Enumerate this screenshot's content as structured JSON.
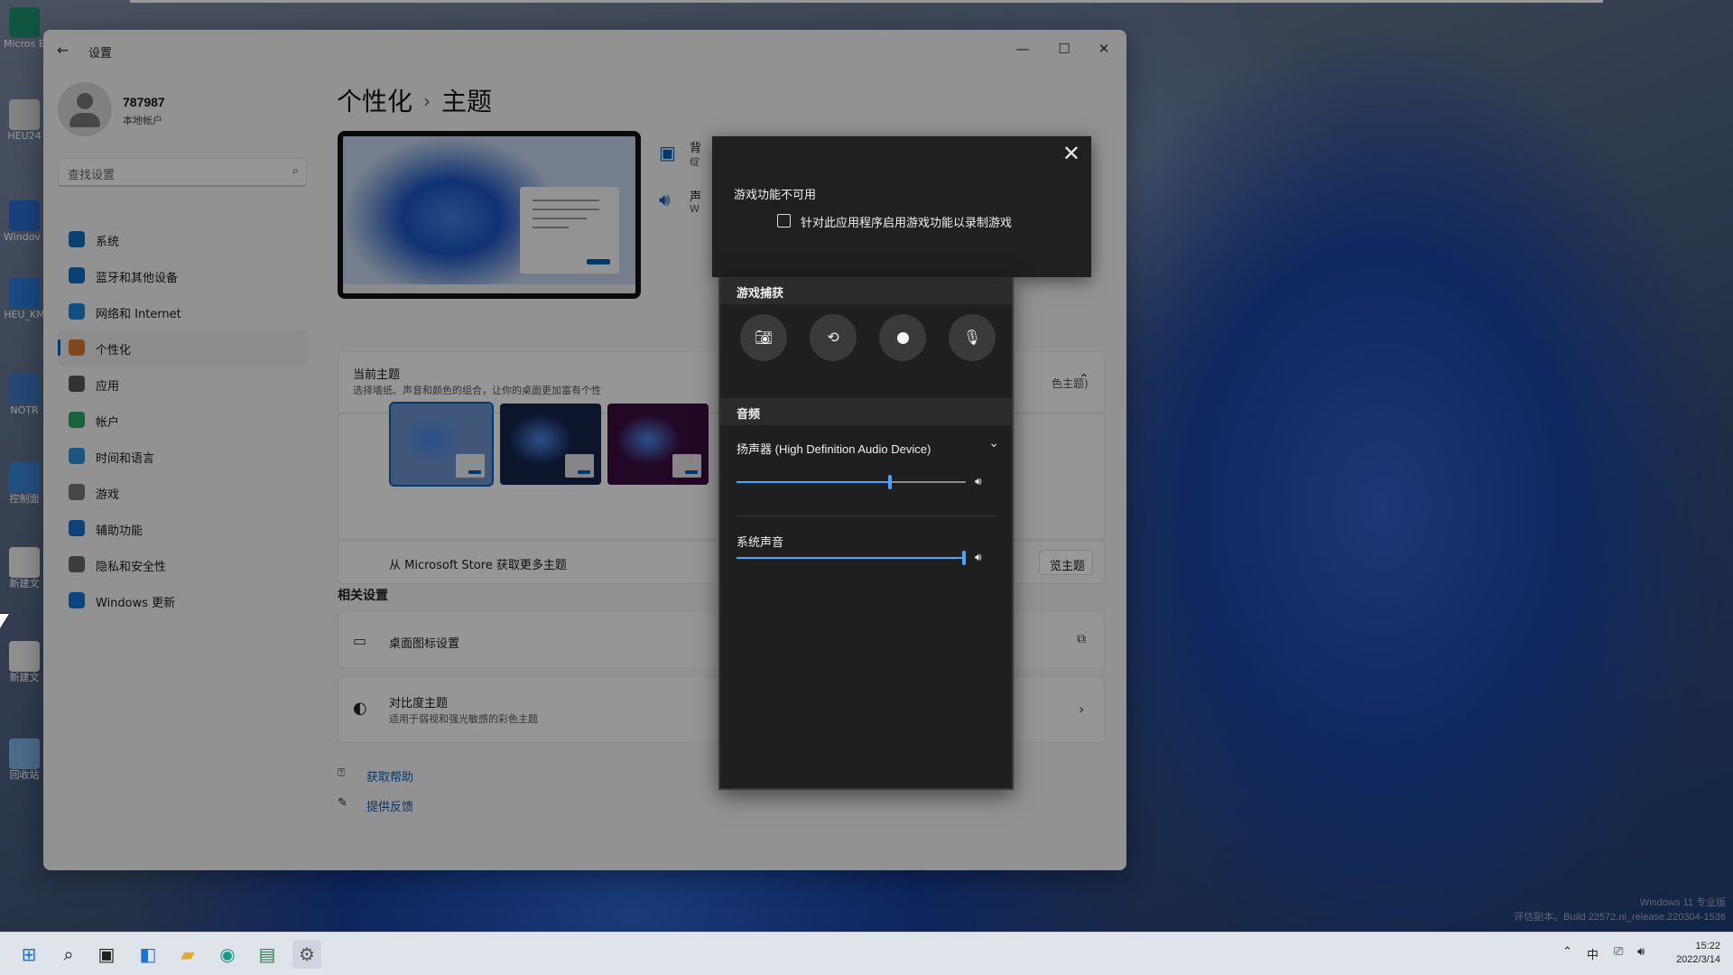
{
  "desktop": {
    "icons": [
      {
        "label": "Micros Edg",
        "color": "#1f8f6f"
      },
      {
        "label": "HEU24",
        "color": "#d9d9d9"
      },
      {
        "label": "Windov 22572.1",
        "color": "#2a6bd1"
      },
      {
        "label": "HEU_KM",
        "color": "#2b7bd6"
      },
      {
        "label": "NOTR",
        "color": "#3f78c9"
      },
      {
        "label": "控制面",
        "color": "#3a86d6"
      },
      {
        "label": "新建文",
        "color": "#eeeeee"
      },
      {
        "label": "新建文",
        "color": "#eeeeee"
      },
      {
        "label": "回收站",
        "color": "#7fb2e6"
      }
    ],
    "watermark_line1": "Windows 11 专业版",
    "watermark_line2": "评估副本。Build 22572.ni_release.220304-1536"
  },
  "settings": {
    "window_title": "设置",
    "back_icon": "back-arrow-icon",
    "user": {
      "name": "787987",
      "account_type": "本地帐户"
    },
    "search_placeholder": "查找设置",
    "nav": [
      {
        "label": "系统",
        "icon": "system-icon",
        "color": "#0f6cbd"
      },
      {
        "label": "蓝牙和其他设备",
        "icon": "bluetooth-icon",
        "color": "#0f6cbd"
      },
      {
        "label": "网络和 Internet",
        "icon": "network-icon",
        "color": "#1a86d8"
      },
      {
        "label": "个性化",
        "icon": "personalization-icon",
        "color": "#d07a2e",
        "active": true
      },
      {
        "label": "应用",
        "icon": "apps-icon",
        "color": "#555555"
      },
      {
        "label": "帐户",
        "icon": "accounts-icon",
        "color": "#2aa36b"
      },
      {
        "label": "时间和语言",
        "icon": "time-language-icon",
        "color": "#2d8fd6"
      },
      {
        "label": "游戏",
        "icon": "gaming-icon",
        "color": "#777777"
      },
      {
        "label": "辅助功能",
        "icon": "accessibility-icon",
        "color": "#1b6fcb"
      },
      {
        "label": "隐私和安全性",
        "icon": "privacy-icon",
        "color": "#666666"
      },
      {
        "label": "Windows 更新",
        "icon": "windows-update-icon",
        "color": "#1476d4"
      }
    ],
    "breadcrumb": {
      "parent": "个性化",
      "separator": "›",
      "current": "主题"
    },
    "side_rows": [
      {
        "label": "背",
        "sub": "绽",
        "icon": "background-icon"
      },
      {
        "label": "声",
        "sub": "W",
        "icon": "sound-icon"
      }
    ],
    "current_theme": {
      "title": "当前主题",
      "subtitle": "选择墙纸、声音和颜色的组合，让你的桌面更加富有个性",
      "value": "色主题)",
      "chevron": "chevron-up-icon",
      "thumbnails": [
        {
          "bg": "#6d92cc",
          "selected": true
        },
        {
          "bg": "#17244a",
          "selected": false
        },
        {
          "bg": "#3a0e3e",
          "selected": false
        }
      ],
      "store_text": "从 Microsoft Store 获取更多主题",
      "browse_button": "览主题"
    },
    "related_title": "相关设置",
    "related": [
      {
        "title": "桌面图标设置",
        "icon": "desktop-icon",
        "action_icon": "external-link-icon"
      },
      {
        "title": "对比度主题",
        "subtitle": "适用于弱视和强光敏感的彩色主题",
        "icon": "contrast-icon",
        "action_icon": "chevron-right-icon"
      }
    ],
    "links": [
      {
        "label": "获取帮助",
        "icon": "help-icon"
      },
      {
        "label": "提供反馈",
        "icon": "feedback-icon"
      }
    ]
  },
  "gamebar": {
    "warning": {
      "message": "游戏功能不可用",
      "checkbox_label": "针对此应用程序启用游戏功能以录制游戏",
      "checked": false
    },
    "capture": {
      "title": "游戏捕获",
      "buttons": [
        {
          "name": "screenshot-button",
          "icon": "camera-icon"
        },
        {
          "name": "record-last-button",
          "icon": "replay-icon"
        },
        {
          "name": "start-recording-button",
          "icon": "record-icon"
        },
        {
          "name": "mic-toggle-button",
          "icon": "mic-off-icon"
        }
      ]
    },
    "audio": {
      "title": "音频",
      "device": "扬声器 (High Definition Audio Device)",
      "device_volume": 0.67,
      "system_label": "系统声音",
      "system_volume": 1.0
    },
    "accent": "#4aa3ff"
  },
  "taskbar": {
    "icons": [
      "start-icon",
      "search-icon",
      "task-view-icon",
      "widgets-icon",
      "file-explorer-icon",
      "edge-icon",
      "notepad-icon",
      "settings-icon"
    ],
    "tray": {
      "language": "中",
      "time": "15:22",
      "date": "2022/3/14"
    }
  }
}
